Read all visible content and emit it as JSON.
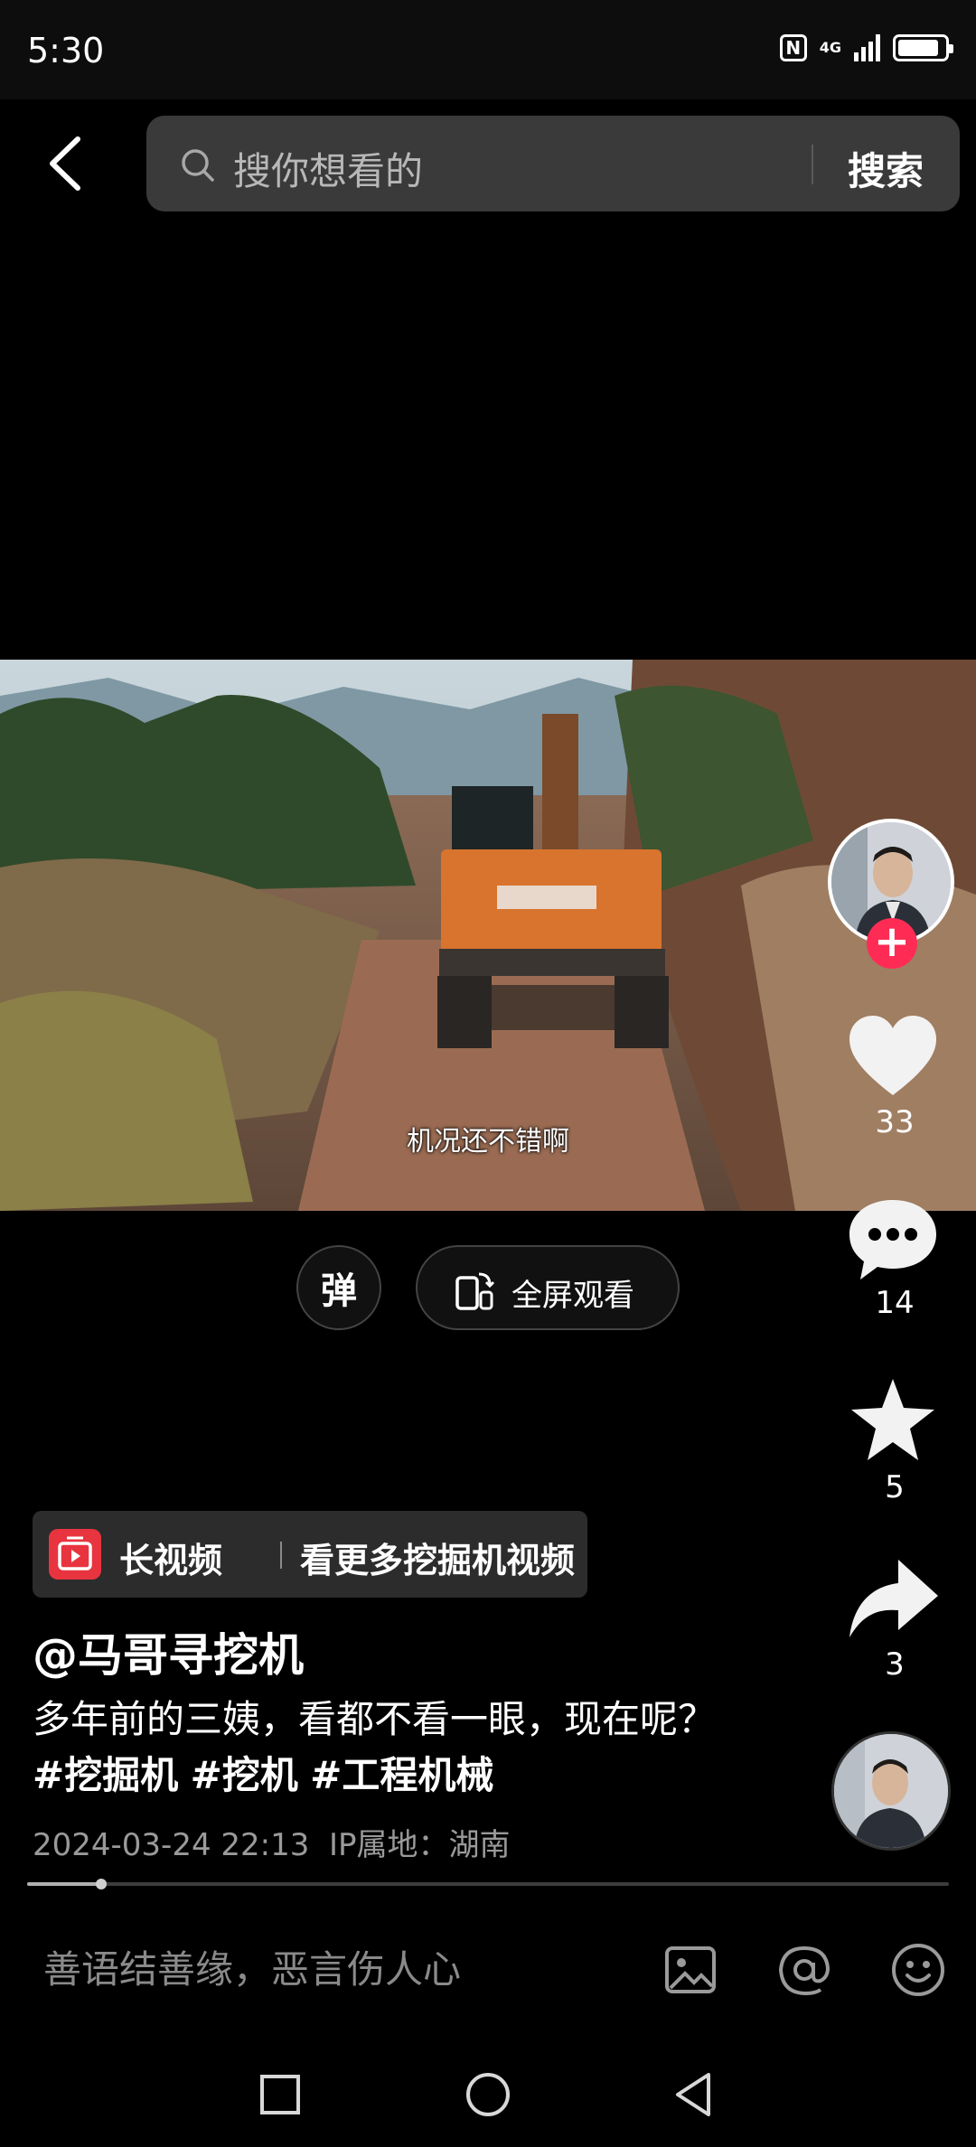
{
  "status_bar": {
    "time": "5:30",
    "network": "4G",
    "battery_level": 0.9
  },
  "search": {
    "placeholder": "搜你想看的",
    "button_label": "搜索"
  },
  "video": {
    "subtitle": "机况还不错啊",
    "danmu_label": "弹",
    "fullscreen_label": "全屏观看"
  },
  "actions": {
    "likes": "33",
    "comments": "14",
    "favorites": "5",
    "shares": "3"
  },
  "long_video_banner": {
    "title": "长视频",
    "text": "看更多挖掘机视频"
  },
  "post": {
    "author": "@马哥寻挖机",
    "caption_text": "多年前的三姨，看都不看一眼，现在呢？",
    "hashtags": [
      "#挖掘机",
      "#挖机",
      "#工程机械"
    ],
    "timestamp": "2024-03-24 22:13",
    "location": "IP属地：湖南"
  },
  "playback": {
    "progress": 0.08
  },
  "comment_bar": {
    "placeholder": "善语结善缘，恶言伤人心"
  },
  "icons": {
    "back": "chevron-left-icon",
    "search": "search-icon",
    "like": "heart-icon",
    "comment": "comment-bubble-icon",
    "favorite": "star-icon",
    "share": "share-arrow-icon",
    "image": "image-icon",
    "mention": "at-icon",
    "emoji": "emoji-icon",
    "recents": "square-icon",
    "home": "circle-icon",
    "back_nav": "triangle-back-icon"
  },
  "colors": {
    "follow": "#fe2c55",
    "long_video": "#e8343f",
    "search_bg": "#3a3a3a"
  }
}
